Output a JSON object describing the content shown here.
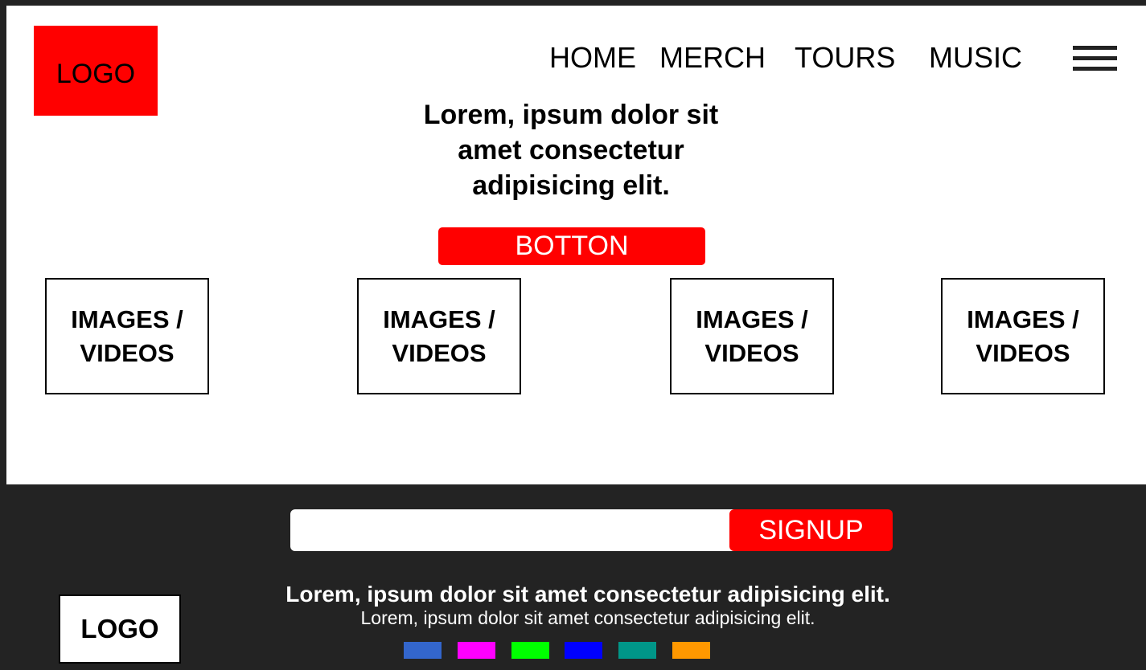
{
  "header": {
    "logo": "LOGO",
    "nav": [
      "HOME",
      "MERCH",
      "TOURS",
      "MUSIC"
    ]
  },
  "hero": {
    "title_lines": [
      "Lorem, ipsum dolor sit",
      "amet consectetur",
      "adipisicing elit."
    ],
    "button_label": "BOTTON"
  },
  "media_tiles": [
    {
      "line1": "IMAGES /",
      "line2": "VIDEOS"
    },
    {
      "line1": "IMAGES /",
      "line2": "VIDEOS"
    },
    {
      "line1": "IMAGES /",
      "line2": "VIDEOS"
    },
    {
      "line1": "IMAGES /",
      "line2": "VIDEOS"
    }
  ],
  "footer": {
    "signup_value": "",
    "signup_button": "SIGNUP",
    "logo": "LOGO",
    "title": "Lorem, ipsum dolor sit amet consectetur adipisicing elit.",
    "subtitle": "Lorem, ipsum dolor sit amet consectetur adipisicing elit.",
    "swatch_colors": [
      "#3366cc",
      "#ff00ff",
      "#00ff00",
      "#0000ff",
      "#009688",
      "#ff9800"
    ]
  },
  "colors": {
    "accent": "#ff0000",
    "background_dark": "#232323",
    "background_light": "#ffffff"
  }
}
